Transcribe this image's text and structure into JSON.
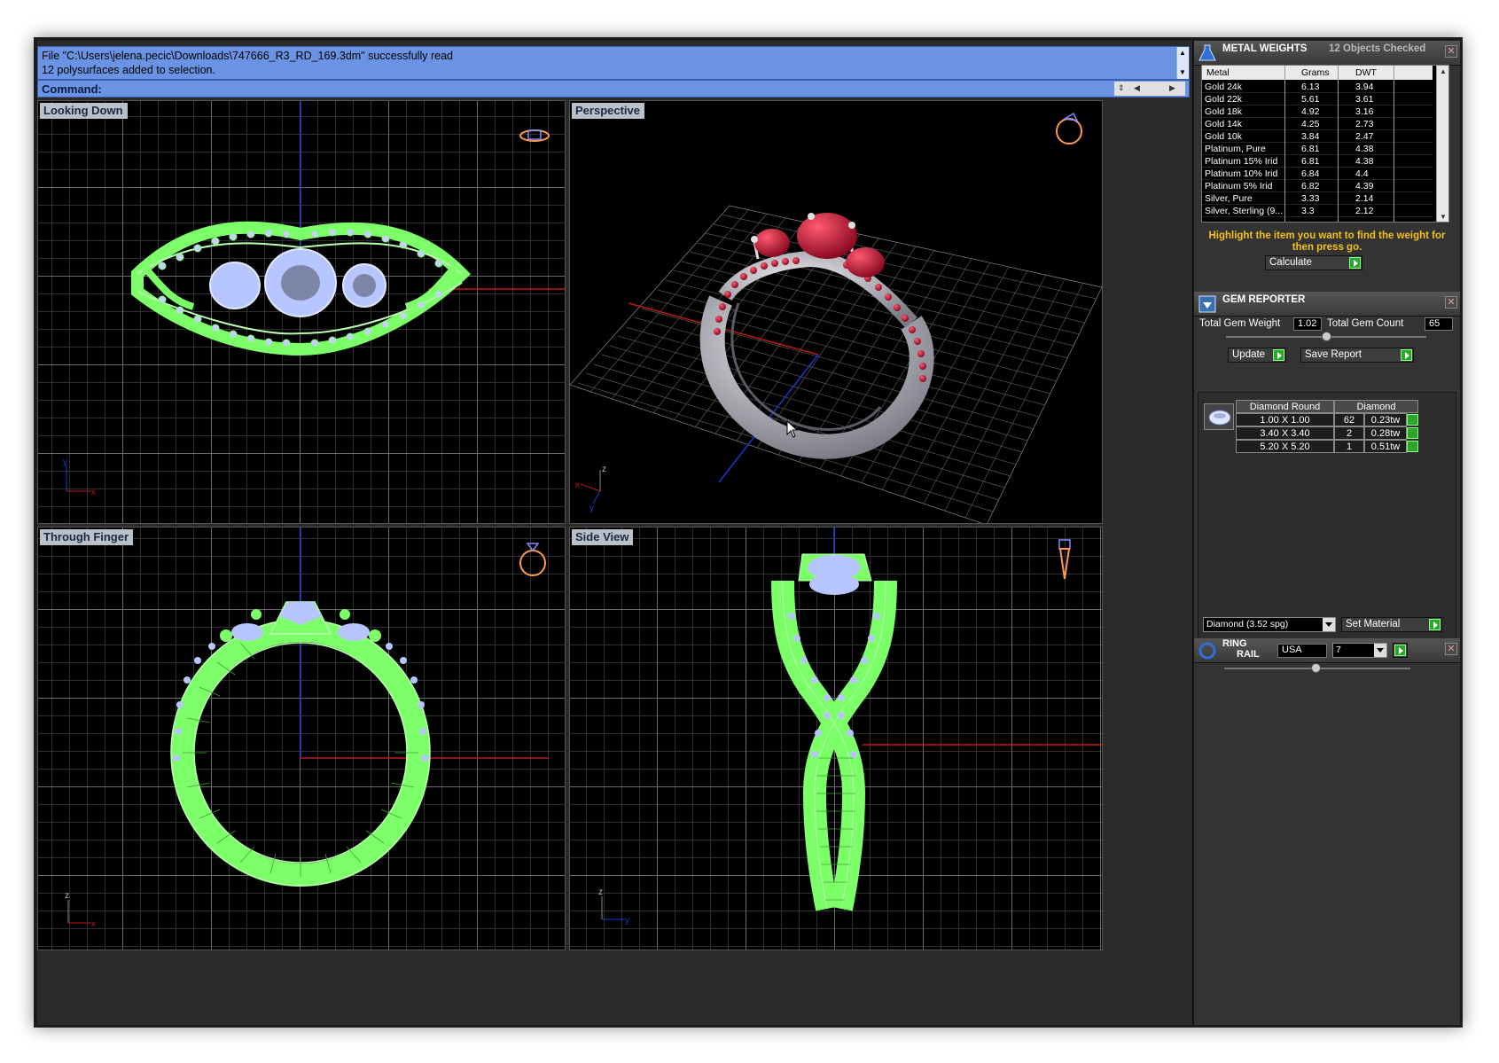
{
  "command": {
    "history": [
      "File \"C:\\Users\\jelena.pecic\\Downloads\\747666_R3_RD_169.3dm\" successfully read",
      "12 polysurfaces added to selection."
    ],
    "prompt_label": "Command:",
    "input_value": ""
  },
  "viewports": {
    "top_left": "Looking Down",
    "top_right": "Perspective",
    "bottom_left": "Through Finger",
    "bottom_right": "Side View"
  },
  "axes": {
    "x": "x",
    "y": "y",
    "z": "z"
  },
  "metal_weights": {
    "title": "METAL WEIGHTS",
    "status": "12 Objects Checked",
    "columns": [
      "Metal",
      "Grams",
      "DWT"
    ],
    "rows": [
      [
        "Gold 24k",
        "6.13",
        "3.94"
      ],
      [
        "Gold 22k",
        "5.61",
        "3.61"
      ],
      [
        "Gold 18k",
        "4.92",
        "3.16"
      ],
      [
        "Gold 14k",
        "4.25",
        "2.73"
      ],
      [
        "Gold 10k",
        "3.84",
        "2.47"
      ],
      [
        "Platinum, Pure",
        "6.81",
        "4.38"
      ],
      [
        "Platinum 15% Irid",
        "6.81",
        "4.38"
      ],
      [
        "Platinum 10% Irid",
        "6.84",
        "4.4"
      ],
      [
        "Platinum 5% Irid",
        "6.82",
        "4.39"
      ],
      [
        "Silver, Pure",
        "3.33",
        "2.14"
      ],
      [
        "Silver, Sterling (9...",
        "3.3",
        "2.12"
      ]
    ],
    "hint": "Highlight the item you want to find the weight for then press go.",
    "calculate_label": "Calculate"
  },
  "gem_reporter": {
    "title": "GEM REPORTER",
    "total_weight_label": "Total Gem Weight",
    "total_weight_value": "1.02",
    "total_count_label": "Total Gem Count",
    "total_count_value": "65",
    "update_label": "Update",
    "save_label": "Save Report",
    "table_headers": [
      "Diamond Round",
      "Diamond"
    ],
    "rows": [
      [
        "1.00 X 1.00",
        "62",
        "0.23tw"
      ],
      [
        "3.40 X 3.40",
        "2",
        "0.28tw"
      ],
      [
        "5.20 X 5.20",
        "1",
        "0.51tw"
      ]
    ],
    "material_select": "Diamond    (3.52 spg)",
    "set_material_label": "Set Material"
  },
  "ring_rail": {
    "title_line1": "RING",
    "title_line2": "RAIL",
    "standard": "USA",
    "size": "7"
  },
  "colors": {
    "command_bg": "#6b93e3",
    "wire_green": "#7dff6a",
    "gem_blue": "#b8c6ff",
    "ruby": "#b0102a",
    "hint_yellow": "#f2c11a",
    "axis_red": "#c01818",
    "axis_blue": "#1a3ad0"
  }
}
